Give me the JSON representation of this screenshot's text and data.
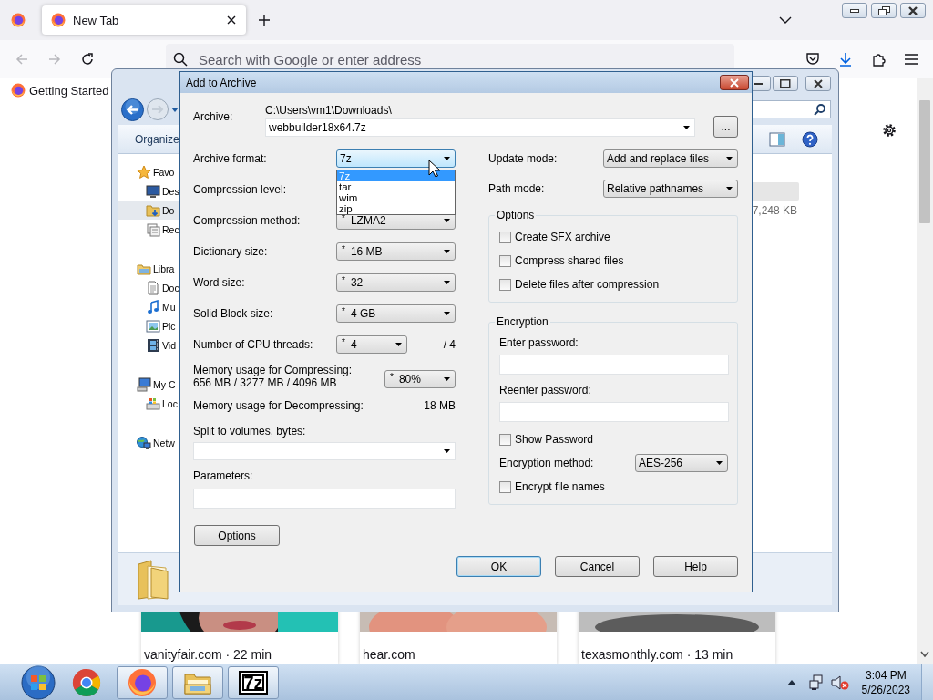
{
  "browser": {
    "tabs": [
      {
        "label": "New Tab",
        "selected": true
      }
    ],
    "address_bar": {
      "placeholder": "Search with Google or enter address"
    },
    "bookmarks": [
      {
        "label": "Getting Started"
      }
    ],
    "cards": [
      {
        "kind": "picture",
        "source": "vanityfair.com · 22 min"
      },
      {
        "kind": "picture",
        "source": "hear.com"
      },
      {
        "kind": "picture",
        "source": "texasmonthly.com · 13 min"
      }
    ]
  },
  "explorer": {
    "organize_button": "Organize",
    "nav_items": [
      {
        "label": "Favo",
        "kind": "favorites",
        "selected": false,
        "children": [
          {
            "label": "Des",
            "kind": "desktop",
            "selected": false
          },
          {
            "label": "Do",
            "kind": "downloads",
            "selected": true
          },
          {
            "label": "Rec",
            "kind": "recent",
            "selected": false
          }
        ]
      },
      {
        "label": "Libra",
        "kind": "libraries",
        "selected": false,
        "children": [
          {
            "label": "Doc",
            "kind": "documents",
            "selected": false
          },
          {
            "label": "Mu",
            "kind": "music",
            "selected": false
          },
          {
            "label": "Pic",
            "kind": "pictures",
            "selected": false
          },
          {
            "label": "Vid",
            "kind": "videos",
            "selected": false
          }
        ]
      },
      {
        "label": "My C",
        "kind": "computer",
        "selected": false,
        "children": [
          {
            "label": "Loc",
            "kind": "disk",
            "selected": false
          }
        ]
      },
      {
        "label": "Netw",
        "kind": "network",
        "selected": false
      }
    ],
    "size_text": "7,248 KB"
  },
  "dialog": {
    "title": "Add to Archive",
    "archive": {
      "label": "Archive:",
      "path": "C:\\Users\\vm1\\Downloads\\",
      "value": "webbuilder18x64.7z",
      "browse_button": "..."
    },
    "left_fields": [
      {
        "label": "Archive format:",
        "value": "7z",
        "focused": true
      },
      {
        "label": "Compression level:"
      },
      {
        "label": "Compression method:",
        "prefix": "*",
        "value": "LZMA2",
        "focused": false
      },
      {
        "label": "Dictionary size:",
        "prefix": "*",
        "value": "16 MB",
        "focused": false
      },
      {
        "label": "Word size:",
        "prefix": "*",
        "value": "32",
        "focused": false
      },
      {
        "label": "Solid Block size:",
        "prefix": "*",
        "value": "4 GB",
        "focused": false
      },
      {
        "label": "Number of CPU threads:",
        "prefix": "*",
        "value": "4",
        "suffix": "/ 4",
        "focused": false
      }
    ],
    "memory": {
      "label": "Memory usage for Compressing:",
      "detail": "656 MB / 3277 MB / 4096 MB",
      "prefix": "*",
      "value": "80%"
    },
    "decompress": {
      "label": "Memory usage for Decompressing:",
      "value": "18 MB"
    },
    "split": {
      "label": "Split to volumes, bytes:"
    },
    "parameters": {
      "label": "Parameters:"
    },
    "options_button": "Options",
    "right_fields": [
      {
        "label": "Update mode:",
        "value": "Add and replace files"
      },
      {
        "label": "Path mode:",
        "value": "Relative pathnames"
      }
    ],
    "options_group": {
      "title": "Options",
      "checkboxes": [
        {
          "label": "Create SFX archive",
          "checked": false
        },
        {
          "label": "Compress shared files",
          "checked": false
        },
        {
          "label": "Delete files after compression",
          "checked": false
        }
      ]
    },
    "encryption": {
      "title": "Encryption",
      "password_label": "Enter password:",
      "reenter_label": "Reenter password:",
      "show_password": {
        "label": "Show Password",
        "checked": false
      },
      "method_label": "Encryption method:",
      "method": "AES-256",
      "encrypt_names": {
        "label": "Encrypt file names",
        "checked": false
      }
    },
    "buttons": [
      {
        "label": "OK",
        "default": true
      },
      {
        "label": "Cancel",
        "default": false
      },
      {
        "label": "Help",
        "default": false
      }
    ],
    "dropdown": {
      "items": [
        {
          "label": "7z",
          "selected": true
        },
        {
          "label": "tar",
          "selected": false
        },
        {
          "label": "wim",
          "selected": false
        },
        {
          "label": "zip",
          "selected": false
        }
      ]
    }
  },
  "taskbar": {
    "apps": [
      {
        "kind": "chrome",
        "open": false
      },
      {
        "kind": "firefox",
        "open": true
      },
      {
        "kind": "explorer",
        "open": true
      },
      {
        "kind": "archiver",
        "open": true,
        "label": "7z"
      }
    ],
    "clock": {
      "time": "3:04 PM",
      "date": "5/26/2023"
    }
  }
}
